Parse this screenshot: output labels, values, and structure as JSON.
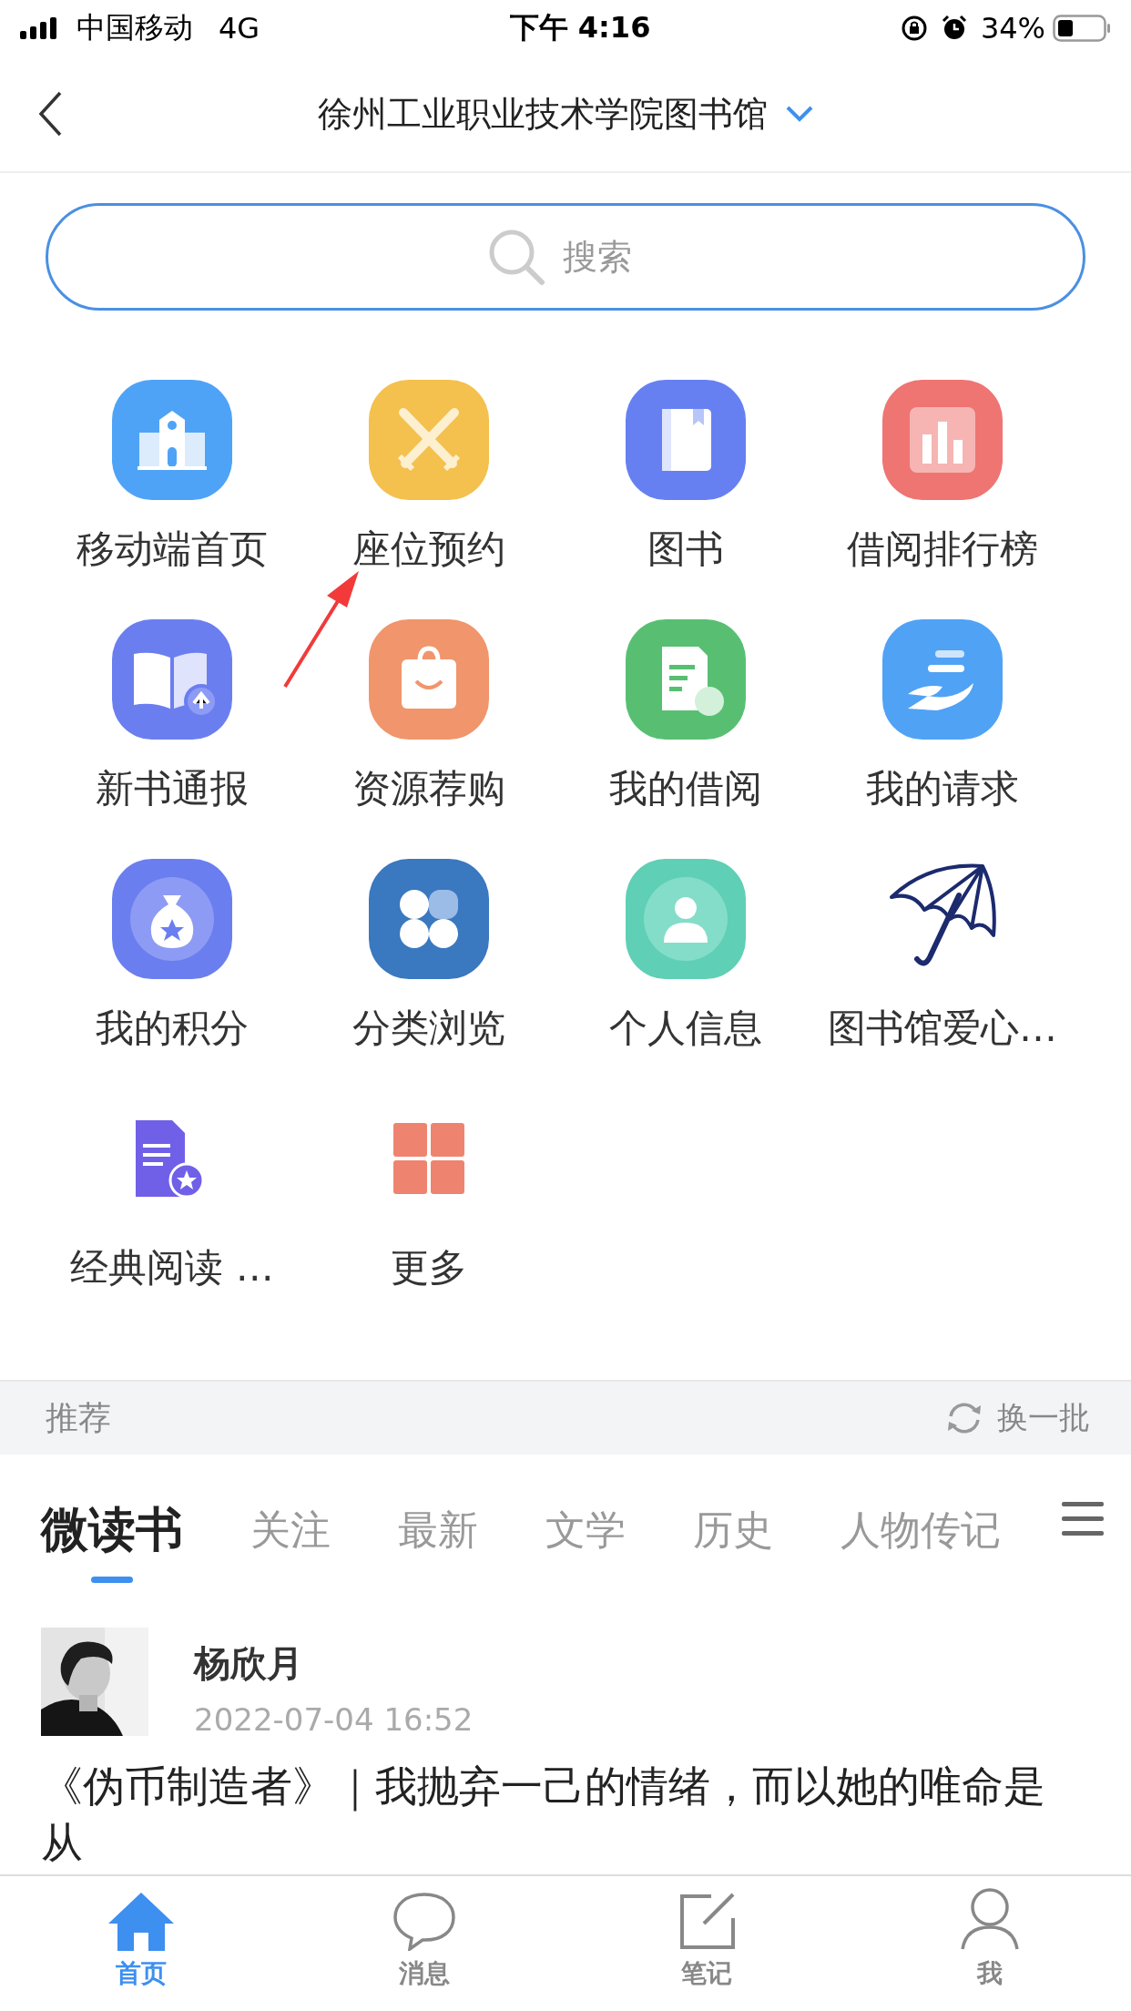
{
  "status_bar": {
    "carrier": "中国移动",
    "network": "4G",
    "time": "下午 4:16",
    "battery": "34%"
  },
  "nav": {
    "title": "徐州工业职业技术学院图书馆"
  },
  "search": {
    "placeholder": "搜索"
  },
  "apps": [
    {
      "label": "移动端首页"
    },
    {
      "label": "座位预约"
    },
    {
      "label": "图书"
    },
    {
      "label": "借阅排行榜"
    },
    {
      "label": "新书通报"
    },
    {
      "label": "资源荐购"
    },
    {
      "label": "我的借阅"
    },
    {
      "label": "我的请求"
    },
    {
      "label": "我的积分"
    },
    {
      "label": "分类浏览"
    },
    {
      "label": "个人信息"
    },
    {
      "label": "图书馆爱心…"
    },
    {
      "label": "经典阅读 …"
    },
    {
      "label": "更多"
    }
  ],
  "recommend": {
    "title": "推荐",
    "refresh": "换一批"
  },
  "tabs": [
    {
      "label": "微读书",
      "selected": true
    },
    {
      "label": "关注",
      "selected": false
    },
    {
      "label": "最新",
      "selected": false
    },
    {
      "label": "文学",
      "selected": false
    },
    {
      "label": "历史",
      "selected": false
    },
    {
      "label": "人物传记",
      "selected": false
    }
  ],
  "post": {
    "author": "杨欣月",
    "time": "2022-07-04 16:52",
    "title": "《伪币制造者》｜我抛弃一己的情绪，而以她的唯命是从"
  },
  "tabbar": [
    {
      "label": "首页",
      "selected": true
    },
    {
      "label": "消息",
      "selected": false
    },
    {
      "label": "笔记",
      "selected": false
    },
    {
      "label": "我",
      "selected": false
    }
  ]
}
